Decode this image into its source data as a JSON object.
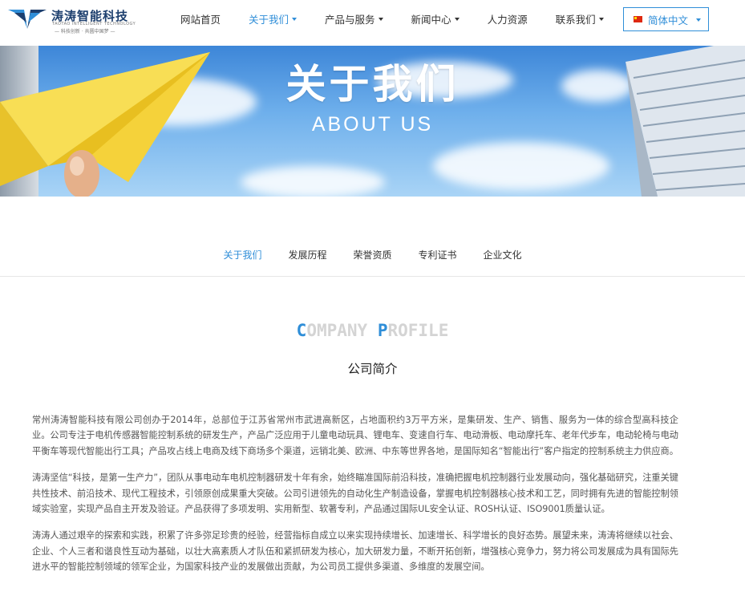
{
  "header": {
    "logo": {
      "title": "涛涛智能科技",
      "subtitle_en": "TAOTAO INTELLIGENT TECHNOLOGY",
      "subtitle_cn": "— 科技创新 · 共圆中国梦 —"
    },
    "nav": [
      {
        "label": "网站首页",
        "dropdown": false,
        "active": false
      },
      {
        "label": "关于我们",
        "dropdown": true,
        "active": true
      },
      {
        "label": "产品与服务",
        "dropdown": true,
        "active": false
      },
      {
        "label": "新闻中心",
        "dropdown": true,
        "active": false
      },
      {
        "label": "人力资源",
        "dropdown": false,
        "active": false
      },
      {
        "label": "联系我们",
        "dropdown": true,
        "active": false
      }
    ],
    "language": {
      "label": "简体中文",
      "flag": "cn-flag-icon"
    }
  },
  "banner": {
    "title": "关于我们",
    "subtitle": "ABOUT US"
  },
  "subnav": [
    {
      "label": "关于我们",
      "active": true
    },
    {
      "label": "发展历程",
      "active": false
    },
    {
      "label": "荣誉资质",
      "active": false
    },
    {
      "label": "专利证书",
      "active": false
    },
    {
      "label": "企业文化",
      "active": false
    }
  ],
  "section": {
    "heading_en_word1_initial": "C",
    "heading_en_word1_rest": "OMPANY",
    "heading_en_word2_initial": "P",
    "heading_en_word2_rest": "ROFILE",
    "heading_cn": "公司简介"
  },
  "paragraphs": [
    "常州涛涛智能科技有限公司创办于2014年，总部位于江苏省常州市武进高新区，占地面积约3万平方米，是集研发、生产、销售、服务为一体的综合型高科技企业。公司专注于电机传感器智能控制系统的研发生产，产品广泛应用于儿童电动玩具、锂电车、变速自行车、电动滑板、电动摩托车、老年代步车，电动轮椅与电动平衡车等现代智能出行工具；产品攻占线上电商及线下商场多个渠道，远销北美、欧洲、中东等世界各地，是国际知名“智能出行”客户指定的控制系统主力供应商。",
    "涛涛坚信“科技，是第一生产力”，团队从事电动车电机控制器研发十年有余，始终瞄准国际前沿科技，准确把握电机控制器行业发展动向，强化基础研究，注重关键共性技术、前沿技术、现代工程技术，引领原创成果重大突破。公司引进领先的自动化生产制造设备，掌握电机控制器核心技术和工艺，同时拥有先进的智能控制领域实验室，实现产品自主开发及验证。产品获得了多项发明、实用新型、软著专利，产品通过国际UL安全认证、ROSH认证、ISO9001质量认证。",
    "涛涛人通过艰辛的探索和实践，积累了许多弥足珍贵的经验，经营指标自成立以来实现持续增长、加速增长、科学增长的良好态势。展望未来，涛涛将继续以社会、企业、个人三者和谐良性互动为基础，以壮大高素质人才队伍和紧抓研发为核心，加大研发力量，不断开拓创新，增强核心竞争力，努力将公司发展成为具有国际先进水平的智能控制领域的领军企业，为国家科技产业的发展做出贡献，为公司员工提供多渠道、多维度的发展空间。"
  ],
  "colors": {
    "accent": "#2f8ed8",
    "logo_navy": "#1d3f6e",
    "heading_grey": "#d4d4d4"
  }
}
